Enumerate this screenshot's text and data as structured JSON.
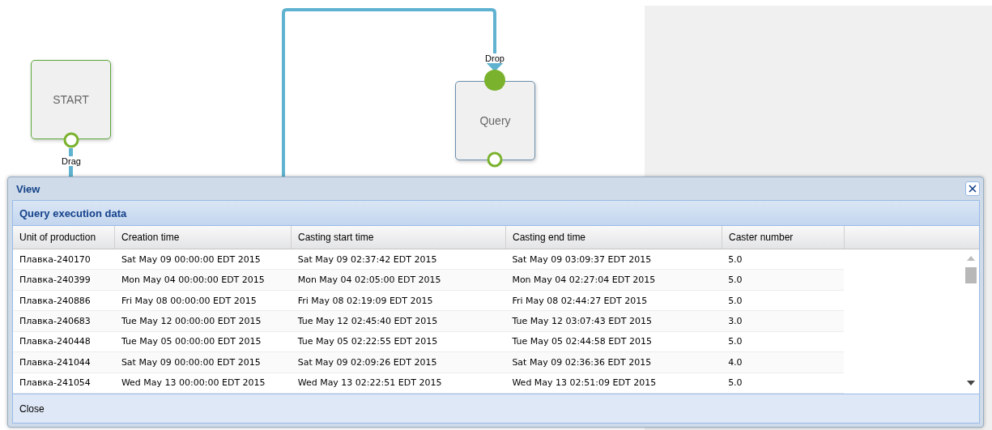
{
  "diagram": {
    "nodes": [
      {
        "label": "START",
        "kind": "start",
        "port_label": "Drag"
      },
      {
        "label": "Query",
        "kind": "task",
        "port_label": "Drop"
      }
    ]
  },
  "dialog": {
    "title": "View",
    "panel_title": "Query execution data",
    "columns": [
      "Unit of production",
      "Creation time",
      "Casting start time",
      "Casting end time",
      "Caster number"
    ],
    "rows": [
      [
        "Плавка-240170",
        "Sat May 09 00:00:00 EDT 2015",
        "Sat May 09 02:37:42 EDT 2015",
        "Sat May 09 03:09:37 EDT 2015",
        "5.0"
      ],
      [
        "Плавка-240399",
        "Mon May 04 00:00:00 EDT 2015",
        "Mon May 04 02:05:00 EDT 2015",
        "Mon May 04 02:27:04 EDT 2015",
        "5.0"
      ],
      [
        "Плавка-240886",
        "Fri May 08 00:00:00 EDT 2015",
        "Fri May 08 02:19:09 EDT 2015",
        "Fri May 08 02:44:27 EDT 2015",
        "5.0"
      ],
      [
        "Плавка-240683",
        "Tue May 12 00:00:00 EDT 2015",
        "Tue May 12 02:45:40 EDT 2015",
        "Tue May 12 03:07:43 EDT 2015",
        "3.0"
      ],
      [
        "Плавка-240448",
        "Tue May 05 00:00:00 EDT 2015",
        "Tue May 05 02:22:55 EDT 2015",
        "Tue May 05 02:44:58 EDT 2015",
        "5.0"
      ],
      [
        "Плавка-241044",
        "Sat May 09 00:00:00 EDT 2015",
        "Sat May 09 02:09:26 EDT 2015",
        "Sat May 09 02:36:36 EDT 2015",
        "4.0"
      ],
      [
        "Плавка-241054",
        "Wed May 13 00:00:00 EDT 2015",
        "Wed May 13 02:22:51 EDT 2015",
        "Wed May 13 02:51:09 EDT 2015",
        "5.0"
      ]
    ],
    "button": "Close"
  }
}
